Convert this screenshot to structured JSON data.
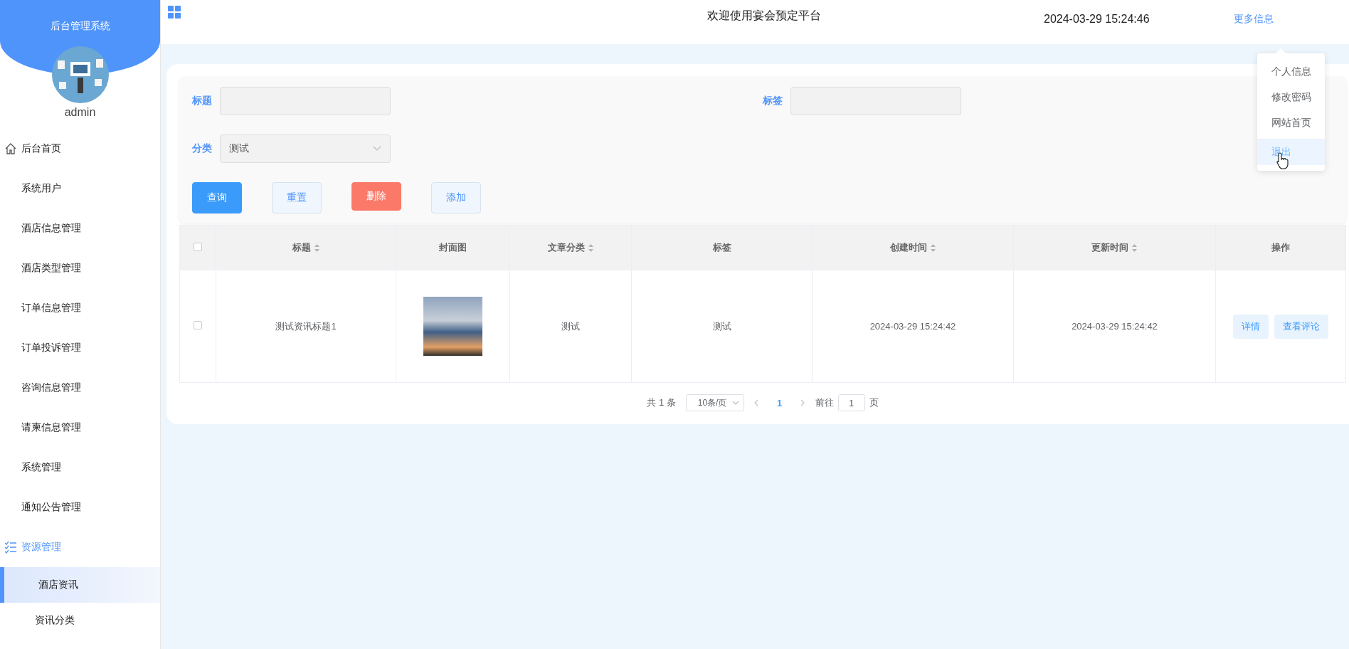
{
  "sidebar": {
    "title": "后台管理系统",
    "username": "admin",
    "items": [
      {
        "label": "后台首页",
        "kind": "home",
        "selected": false
      },
      {
        "label": "系统用户",
        "kind": "plain",
        "selected": false
      },
      {
        "label": "酒店信息管理",
        "kind": "plain",
        "selected": false
      },
      {
        "label": "酒店类型管理",
        "kind": "plain",
        "selected": false
      },
      {
        "label": "订单信息管理",
        "kind": "plain",
        "selected": false
      },
      {
        "label": "订单投诉管理",
        "kind": "plain",
        "selected": false
      },
      {
        "label": "咨询信息管理",
        "kind": "plain",
        "selected": false
      },
      {
        "label": "请柬信息管理",
        "kind": "plain",
        "selected": false
      },
      {
        "label": "系统管理",
        "kind": "plain",
        "selected": false
      },
      {
        "label": "通知公告管理",
        "kind": "plain",
        "selected": false
      },
      {
        "label": "资源管理",
        "kind": "group",
        "selected": false,
        "expanded": true,
        "children": [
          {
            "label": "酒店资讯",
            "selected": true
          },
          {
            "label": "资讯分类",
            "selected": false
          }
        ]
      }
    ]
  },
  "header": {
    "title": "欢迎使用宴会预定平台",
    "datetime": "2024-03-29 15:24:46",
    "more_link": "更多信息"
  },
  "user_menu": {
    "items": [
      {
        "label": "个人信息",
        "highlighted": false
      },
      {
        "label": "修改密码",
        "highlighted": false
      },
      {
        "label": "网站首页",
        "highlighted": false
      },
      {
        "label": "退出",
        "highlighted": true
      }
    ]
  },
  "search": {
    "fields": [
      {
        "label": "标题",
        "kind": "input"
      },
      {
        "label": "标签",
        "kind": "input"
      },
      {
        "label": "分类",
        "kind": "select",
        "value": "测试"
      }
    ],
    "buttons": [
      {
        "label": "查询",
        "kind": "primary"
      },
      {
        "label": "重置",
        "kind": "plain"
      },
      {
        "label": "删除",
        "kind": "danger"
      },
      {
        "label": "添加",
        "kind": "plain"
      }
    ]
  },
  "table": {
    "all_checked": false,
    "columns": [
      {
        "label": "标题",
        "sortable": true
      },
      {
        "label": "封面图",
        "sortable": false
      },
      {
        "label": "文章分类",
        "sortable": true
      },
      {
        "label": "标签",
        "sortable": false
      },
      {
        "label": "创建时间",
        "sortable": true
      },
      {
        "label": "更新时间",
        "sortable": true
      },
      {
        "label": "操作",
        "sortable": false
      }
    ],
    "rows": [
      {
        "checked": false,
        "title": "测试资讯标题1",
        "category": "测试",
        "tag": "测试",
        "created": "2024-03-29 15:24:42",
        "updated": "2024-03-29 15:24:42",
        "actions": [
          "详情",
          "查看评论"
        ]
      }
    ]
  },
  "pagination": {
    "total": "共 1 条",
    "page_size": "10条/页",
    "pages": [
      {
        "label": "1",
        "selected": true
      }
    ],
    "goto_label": "前往",
    "goto_value": "1",
    "goto_suffix": "页"
  }
}
